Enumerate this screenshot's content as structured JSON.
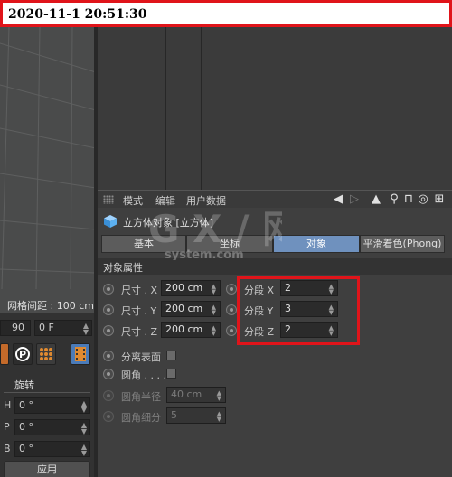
{
  "timestamp": "2020-11-1 20:51:30",
  "viewport": {
    "grid_spacing": "网格间距 : 100 cm"
  },
  "timeline": {
    "frame_value": "90",
    "frame_field": "0 F"
  },
  "rotation": {
    "title": "旋转",
    "fields": [
      {
        "label": "H",
        "value": "0 °"
      },
      {
        "label": "P",
        "value": "0 °"
      },
      {
        "label": "B",
        "value": "0 °"
      }
    ],
    "apply_label": "应用"
  },
  "attribute_manager": {
    "menu": [
      "模式",
      "编辑",
      "用户数据"
    ],
    "object_title": "立方体对象 [立方体]",
    "tabs": [
      {
        "label": "基本",
        "active": false
      },
      {
        "label": "坐标",
        "active": false
      },
      {
        "label": "对象",
        "active": true
      },
      {
        "label": "平滑着色(Phong)",
        "active": false
      }
    ],
    "section": "对象属性",
    "size": [
      {
        "label": "尺寸 . X",
        "value": "200 cm"
      },
      {
        "label": "尺寸 . Y",
        "value": "200 cm"
      },
      {
        "label": "尺寸 . Z",
        "value": "200 cm"
      }
    ],
    "segments": [
      {
        "label": "分段 X",
        "value": "2"
      },
      {
        "label": "分段 Y",
        "value": "3"
      },
      {
        "label": "分段 Z",
        "value": "2"
      }
    ],
    "separate_surfaces": "分离表面",
    "fillet": "圆角 . . . .",
    "fillet_radius": {
      "label": "圆角半径",
      "value": "40 cm"
    },
    "fillet_subdivision": {
      "label": "圆角细分",
      "value": "5"
    }
  },
  "watermark": {
    "big": "G X / 网",
    "small": "system.com"
  },
  "colors": {
    "highlight": "#e0141a",
    "active_tab": "#6f91be"
  }
}
